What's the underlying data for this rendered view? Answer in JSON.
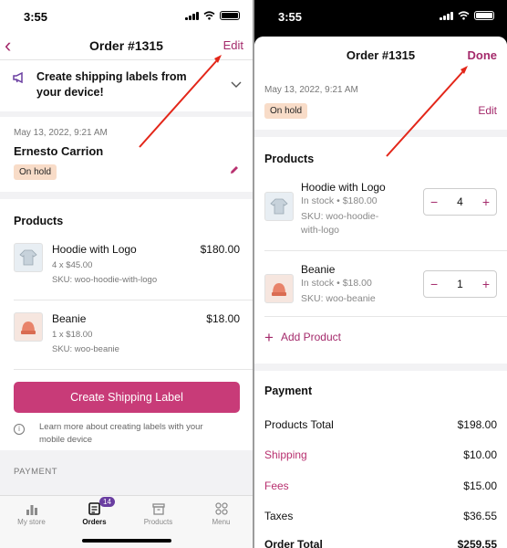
{
  "left": {
    "status_time": "3:55",
    "nav": {
      "back_icon": "chevron-left-icon",
      "title": "Order #1315",
      "edit_label": "Edit"
    },
    "banner": {
      "icon": "megaphone-icon",
      "text": "Create shipping labels from your device!"
    },
    "customer": {
      "date": "May 13, 2022, 9:21 AM",
      "name": "Ernesto  Carrion",
      "status": "On hold"
    },
    "products": {
      "heading": "Products",
      "items": [
        {
          "name": "Hoodie with Logo",
          "price": "$180.00",
          "qty": "4 x $45.00",
          "sku": "SKU: woo-hoodie-with-logo"
        },
        {
          "name": "Beanie",
          "price": "$18.00",
          "qty": "1 x $18.00",
          "sku": "SKU: woo-beanie"
        }
      ],
      "create_label_button": "Create Shipping Label",
      "learn_text": "Learn more about creating labels with your mobile device"
    },
    "payment_heading": "PAYMENT",
    "tabs": [
      {
        "label": "My store",
        "icon": "bar-chart-icon"
      },
      {
        "label": "Orders",
        "icon": "orders-icon",
        "badge": "14"
      },
      {
        "label": "Products",
        "icon": "archive-box-icon"
      },
      {
        "label": "Menu",
        "icon": "grid-icon"
      }
    ]
  },
  "right": {
    "status_time": "3:55",
    "header": {
      "title": "Order #1315",
      "done_label": "Done",
      "date": "May 13, 2022, 9:21 AM",
      "status": "On hold",
      "edit_label": "Edit"
    },
    "products": {
      "heading": "Products",
      "items": [
        {
          "name": "Hoodie with Logo",
          "stock": "In stock • $180.00",
          "sku": "SKU: woo-hoodie-with-logo",
          "quantity": "4"
        },
        {
          "name": "Beanie",
          "stock": "In stock • $18.00",
          "sku": "SKU: woo-beanie",
          "quantity": "1"
        }
      ],
      "add_product": "Add Product"
    },
    "payment": {
      "heading": "Payment",
      "rows": [
        {
          "label": "Products Total",
          "value": "$198.00"
        },
        {
          "label": "Shipping",
          "value": "$10.00"
        },
        {
          "label": "Fees",
          "value": "$15.00"
        },
        {
          "label": "Taxes",
          "value": "$36.55"
        },
        {
          "label": "Order Total",
          "value": "$259.55"
        }
      ]
    }
  },
  "colors": {
    "accent": "#a42a6b",
    "button": "#c83b78",
    "badge_bg": "#f8dcc8",
    "annotation": "#e32619",
    "orders_badge": "#6a3ea1"
  }
}
